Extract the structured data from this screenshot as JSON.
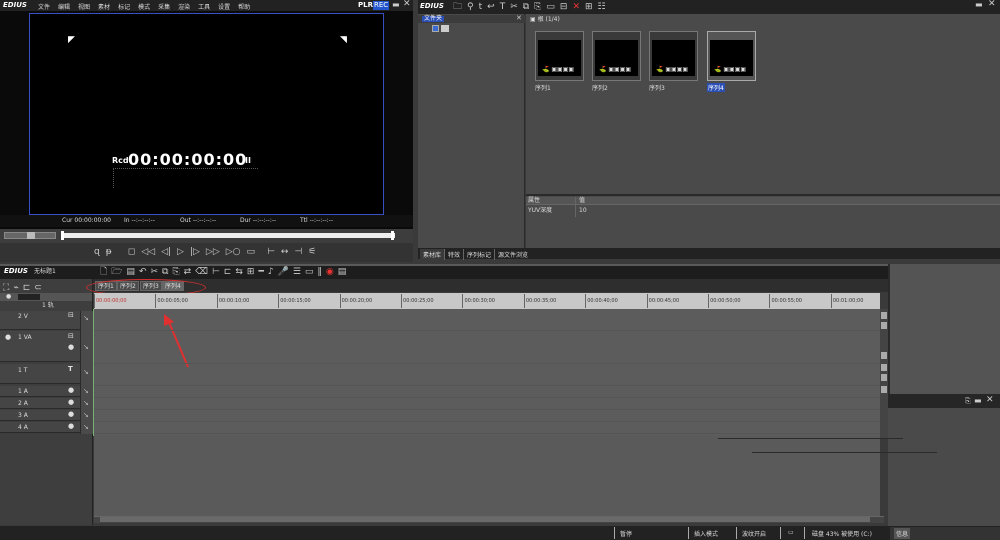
{
  "player": {
    "logo": "EDIUS",
    "menu": [
      "文件",
      "编辑",
      "视图",
      "素材",
      "标记",
      "模式",
      "采集",
      "渲染",
      "工具",
      "设置",
      "帮助"
    ],
    "mode_plr": "PLR",
    "mode_rec": "REC",
    "rcd_label": "Rcd",
    "timecode": "00:00:00:00",
    "status": [
      {
        "label": "Cur",
        "value": "00:00:00:00"
      },
      {
        "label": "In",
        "value": "--:--:--:--"
      },
      {
        "label": "Out",
        "value": "--:--:--:--"
      },
      {
        "label": "Dur",
        "value": "--:--:--:--"
      },
      {
        "label": "Ttl",
        "value": "--:--:--:--"
      }
    ]
  },
  "bin": {
    "logo": "EDIUS",
    "folder_header": "文件夹",
    "path": "根 (1/4)",
    "thumbs": [
      "序列1",
      "序列2",
      "序列3",
      "序列4"
    ],
    "props_col1": "属性",
    "props_col2": "值",
    "prop_name": "YUV深度",
    "prop_value": "10",
    "tabs": [
      "素材库",
      "特效",
      "序列标记",
      "源文件浏览"
    ]
  },
  "timeline": {
    "logo": "EDIUS",
    "project": "无标题1",
    "seq_tabs": [
      "序列1",
      "序列2",
      "序列3",
      "序列4"
    ],
    "ruler": [
      "00:00:00;00",
      "00:00:05;00",
      "00:00:10;00",
      "00:00:15;00",
      "00:00:20;00",
      "00:00:25;00",
      "00:00:30;00",
      "00:00:35;00",
      "00:00:40;00",
      "00:00:45;00",
      "00:00:50;00",
      "00:00:55;00",
      "00:01:00;00"
    ],
    "mode_label": "1 轨",
    "tracks": [
      "2 V",
      "1 VA",
      "1 T",
      "1 A",
      "2 A",
      "3 A",
      "4 A"
    ]
  },
  "statusbar": {
    "pause": "暂停",
    "insert": "插入模式",
    "ripple": "波纹开启",
    "disk": "磁盘 43% 被使用 (C:)",
    "info_tab": "信息"
  }
}
